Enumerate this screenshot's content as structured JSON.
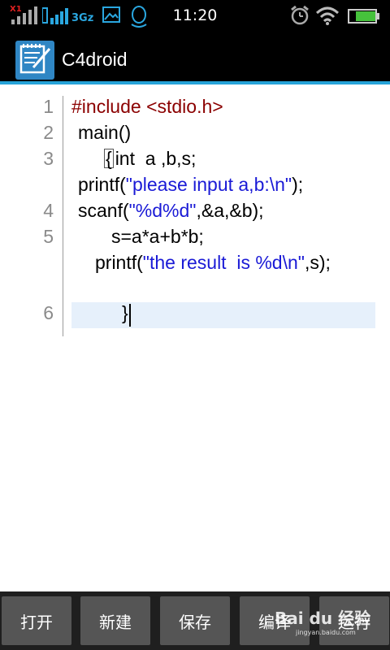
{
  "status_bar": {
    "sim_label": "X1",
    "network_label": "3Gz",
    "time": "11:20"
  },
  "app_bar": {
    "title": "C4droid",
    "logo_icon": "notepad-pen-icon"
  },
  "editor": {
    "line_numbers": [
      "1",
      "2",
      "3",
      "4",
      "5",
      "6"
    ],
    "lines": {
      "l1_kw": "#include <stdio.h>",
      "l2": "main()",
      "l3_brace": "{",
      "l3_rest": "int  a ,b,s;",
      "l3b_a": "printf(",
      "l3b_str": "\"please input a,b:\\n\"",
      "l3b_b": ");",
      "l4_a": "scanf(",
      "l4_str": "\"%d%d\"",
      "l4_b": ",&a,&b);",
      "l5": "s=a*a+b*b;",
      "l5b_a": "printf(",
      "l5b_str": "\"the result  is %d\\n\"",
      "l5b_b": ",s);",
      "l6": "}"
    }
  },
  "bottom_bar": {
    "open_label": "打开",
    "new_label": "新建",
    "save_label": "保存",
    "compile_label": "编译",
    "run_label": "运行"
  },
  "watermark": {
    "text": "Bai du 经验",
    "subtext": "jingyan.baidu.com"
  },
  "colors": {
    "accent": "#27a3d8",
    "keyword": "#8b0000",
    "string": "#1a1ad6",
    "current_line": "#e6f0fb"
  }
}
